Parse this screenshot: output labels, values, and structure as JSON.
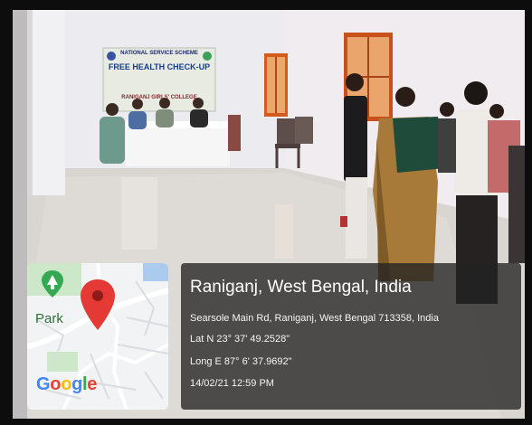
{
  "banner": {
    "line1": "NATIONAL SERVICE SCHEME",
    "line2": "FREE HEALTH CHECK-UP",
    "line3": "RANIGANJ GIRLS' COLLEGE"
  },
  "map": {
    "park_label": "Park",
    "logo": [
      "G",
      "o",
      "o",
      "g",
      "l",
      "e"
    ],
    "logo_colors": [
      "#4285F4",
      "#EA4335",
      "#FBBC05",
      "#4285F4",
      "#34A853",
      "#EA4335"
    ]
  },
  "location": {
    "city": "Raniganj, West Bengal, India",
    "address": "Searsole Main Rd, Raniganj, West Bengal 713358, India",
    "latitude": "Lat N 23° 37' 49.2528\"",
    "longitude": "Long E 87° 6' 37.9692\"",
    "timestamp": "14/02/21 12:59 PM"
  }
}
